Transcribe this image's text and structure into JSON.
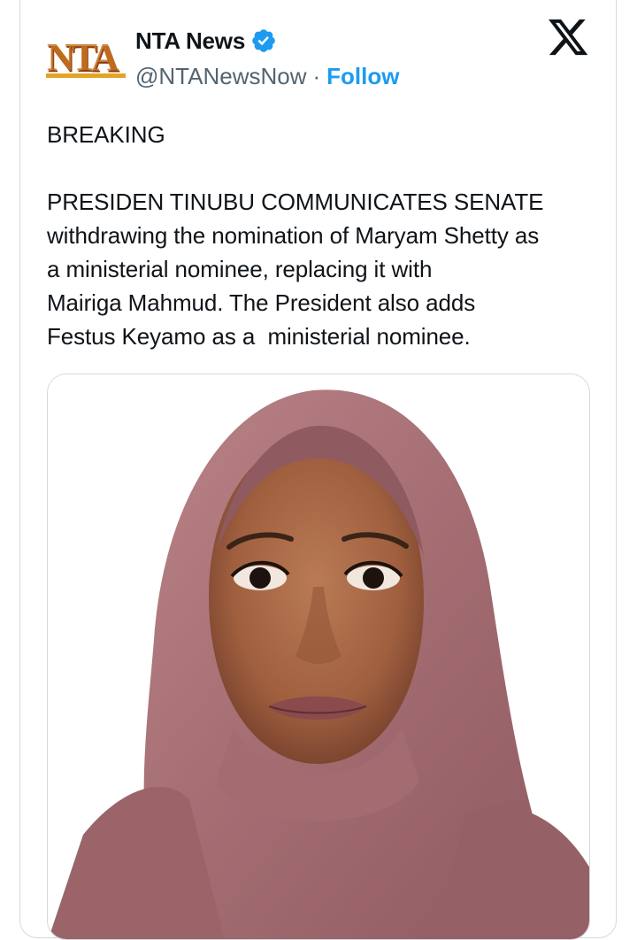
{
  "tweet": {
    "author_name": "NTA News",
    "handle": "@NTANewsNow",
    "separator": "·",
    "follow_label": "Follow",
    "line_breaking": "BREAKING",
    "body_lines": [
      "PRESIDEN TINUBU COMMUNICATES SENATE",
      "withdrawing the nomination of Maryam Shetty as",
      "a ministerial nominee, replacing it with",
      "Mairiga Mahmud. The President also adds",
      "Festus Keyamo as a  ministerial nominee."
    ]
  },
  "logo": {
    "letters": "NTA",
    "colors": [
      "#c46a1a",
      "#7a2f10",
      "#e8a020"
    ]
  },
  "icons": {
    "verified": "verified-badge-icon",
    "platform": "x-logo-icon"
  },
  "colors": {
    "link": "#1d9bf0",
    "secondary_text": "#536471",
    "border": "#cfd9de",
    "hijab": "#a87276",
    "skin": "#a56744"
  }
}
